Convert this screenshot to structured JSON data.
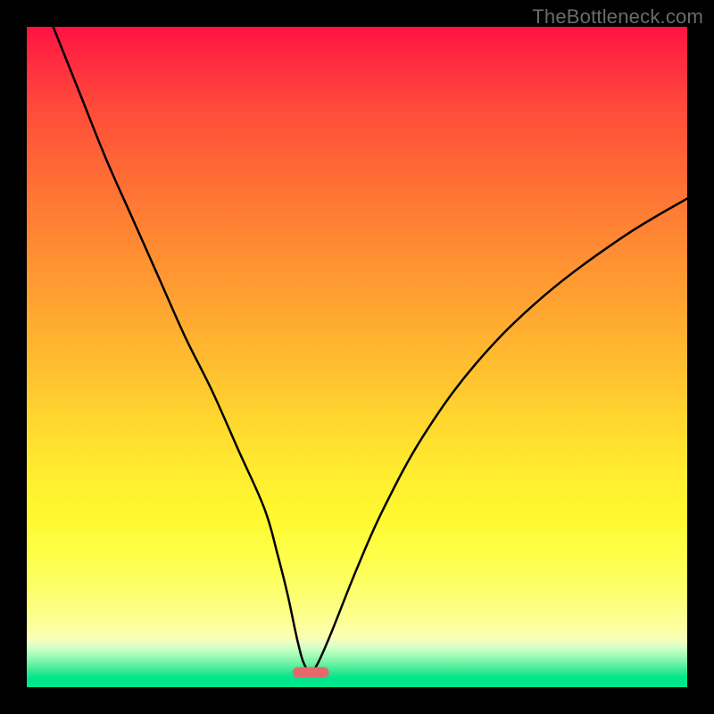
{
  "watermark": "TheBottleneck.com",
  "chart_data": {
    "type": "line",
    "title": "",
    "xlabel": "",
    "ylabel": "",
    "xlim": [
      0,
      100
    ],
    "ylim": [
      0,
      100
    ],
    "grid": false,
    "series": [
      {
        "name": "curve",
        "x": [
          4,
          8,
          12,
          16,
          20,
          24,
          28,
          32,
          36,
          38,
          39.5,
          41,
          42,
          43,
          44,
          46,
          50,
          54,
          60,
          68,
          78,
          90,
          100
        ],
        "y": [
          100,
          90,
          80,
          71,
          62,
          53,
          45,
          36,
          27,
          20,
          14,
          7,
          3.5,
          2.5,
          3.5,
          8,
          18,
          27,
          38,
          49,
          59,
          68,
          74
        ]
      }
    ],
    "marker": {
      "x": 43,
      "y": 2.25,
      "width": 5.5,
      "height": 1.6,
      "color": "#e4696c"
    },
    "colors": {
      "curve": "#000000",
      "frame": "#000000",
      "gradient_top": "#ff1342",
      "gradient_bottom": "#00e68b",
      "marker": "#e4696c"
    },
    "background_gradient_stops": [
      {
        "pct": 0,
        "color": "#ff1342"
      },
      {
        "pct": 20,
        "color": "#ff6436"
      },
      {
        "pct": 44,
        "color": "#ffa930"
      },
      {
        "pct": 68,
        "color": "#ffed2f"
      },
      {
        "pct": 85,
        "color": "#fcff68"
      },
      {
        "pct": 93,
        "color": "#e8ffc6"
      },
      {
        "pct": 100,
        "color": "#00e68b"
      }
    ]
  }
}
